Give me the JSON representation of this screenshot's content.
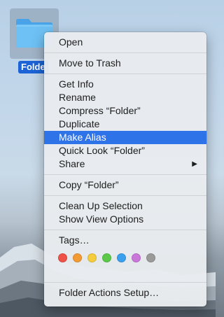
{
  "desktop": {
    "folder_label": "Folde",
    "folder_color": "#5eb4ef"
  },
  "context_menu": {
    "open": "Open",
    "move_to_trash": "Move to Trash",
    "get_info": "Get Info",
    "rename": "Rename",
    "compress": "Compress “Folder”",
    "duplicate": "Duplicate",
    "make_alias": "Make Alias",
    "quick_look": "Quick Look “Folder”",
    "share": "Share",
    "share_arrow": "▶",
    "copy": "Copy “Folder”",
    "clean_up_selection": "Clean Up Selection",
    "show_view_options": "Show View Options",
    "tags": "Tags…",
    "tag_colors": [
      {
        "name": "red",
        "hex": "#ee5147"
      },
      {
        "name": "orange",
        "hex": "#f39a35"
      },
      {
        "name": "yellow",
        "hex": "#f4cc3d"
      },
      {
        "name": "green",
        "hex": "#5cc84a"
      },
      {
        "name": "blue",
        "hex": "#3aa0ee"
      },
      {
        "name": "purple",
        "hex": "#c977d9"
      },
      {
        "name": "gray",
        "hex": "#9a9a9a"
      }
    ],
    "folder_actions_setup": "Folder Actions Setup…",
    "highlight_color": "#2f73e8"
  }
}
